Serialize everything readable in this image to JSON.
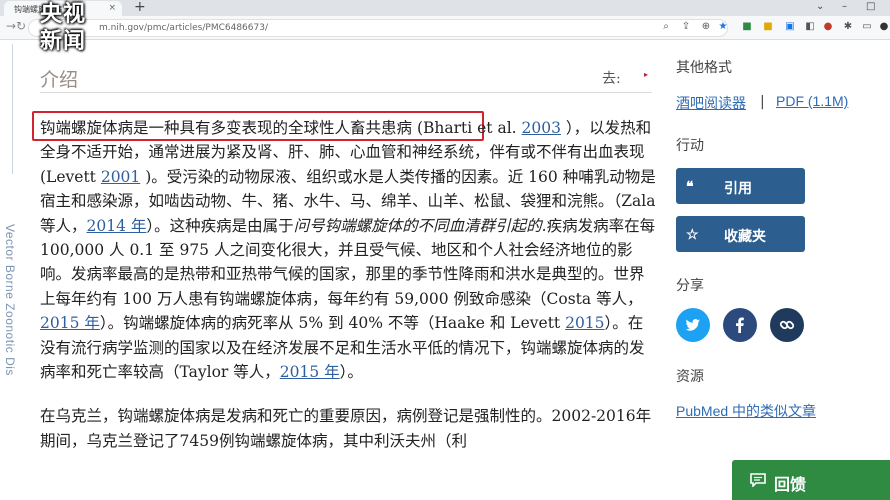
{
  "browser": {
    "tab_title": "钩端螺旋体病",
    "url_host": "www.ncbi.nlm.nih.gov",
    "url_path": "/pmc/articles/PMC6486673/",
    "url_display": "m.nih.gov/pmc/articles/PMC6486673/"
  },
  "logo": {
    "line1": "央视",
    "line2": "新闻"
  },
  "left_tab": {
    "label": "Vector Borne Zoonotic Dis"
  },
  "article": {
    "section_title": "介绍",
    "goto_label": "去:",
    "paragraph1": [
      {
        "t": "钩端螺旋体病是一种具有多变表现的全球性人畜共患病",
        "hl": true
      },
      {
        "t": " (Bharti et al. "
      },
      {
        "t": "2003",
        "link": true
      },
      {
        "t": " ），以发热和全身不适开始，通常进展为紧及肾、肝、肺、心血管和神经系统，伴有或不伴有出血表现 (Levett "
      },
      {
        "t": "2001",
        "link": true
      },
      {
        "t": " )。受污染的动物尿液、组织或水是人类传播的因素。近 160 种哺乳动物是宿主和感染源，如啮齿动物、牛、猪、水牛、马、绵羊、山羊、松鼠、袋狸和浣熊。（Zala 等人，"
      },
      {
        "t": "2014 年",
        "link": true
      },
      {
        "t": "）。这种疾病是由属于"
      },
      {
        "t": "问号钩端螺旋体的不同血清群引起的.",
        "italic": true
      },
      {
        "t": "疾病发病率在每 100,000 人 0.1 至 975 人之间变化很大，并且受气候、地区和个人社会经济地位的影响。发病率最高的是热带和亚热带气候的国家，那里的季节性降雨和洪水是典型的。世界上每年约有 100 万人患有钩端螺旋体病，每年约有 59,000 例致命感染（Costa 等人，"
      },
      {
        "t": "2015 年",
        "link": true
      },
      {
        "t": "）。钩端螺旋体病的病死率从 5% 到 40% 不等（Haake 和 Levett "
      },
      {
        "t": "2015",
        "link": true
      },
      {
        "t": "）。在没有流行病学监测的国家以及在经济发展不足和生活水平低的情况下，钩端螺旋体病的发病率和死亡率较高（Taylor 等人，"
      },
      {
        "t": "2015 年",
        "link": true
      },
      {
        "t": "）。"
      }
    ],
    "paragraph2": "在乌克兰，钩端螺旋体病是发病和死亡的重要原因，病例登记是强制性的。2002-2016年期间，乌克兰登记了7459例钩端螺旋体病，其中利沃夫州（利"
  },
  "sidebar": {
    "other_formats_heading": "其他格式",
    "reader_link": "酒吧阅读器",
    "separator": "|",
    "pdf_link": "PDF (1.1M)",
    "actions_heading": "行动",
    "cite_label": "引用",
    "favorite_label": "收藏夹",
    "share_heading": "分享",
    "resources_heading": "资源",
    "pubmed_link": "PubMed 中的类似文章"
  },
  "feedback": {
    "label": "回馈"
  },
  "colors": {
    "accent_button": "#2c5e8f",
    "link": "#2f6bb3",
    "twitter": "#1da1f2",
    "facebook": "#2c4a7d",
    "permalink": "#1f3a5c",
    "feedback": "#2f8a42",
    "highlight_box": "#d4222f"
  }
}
